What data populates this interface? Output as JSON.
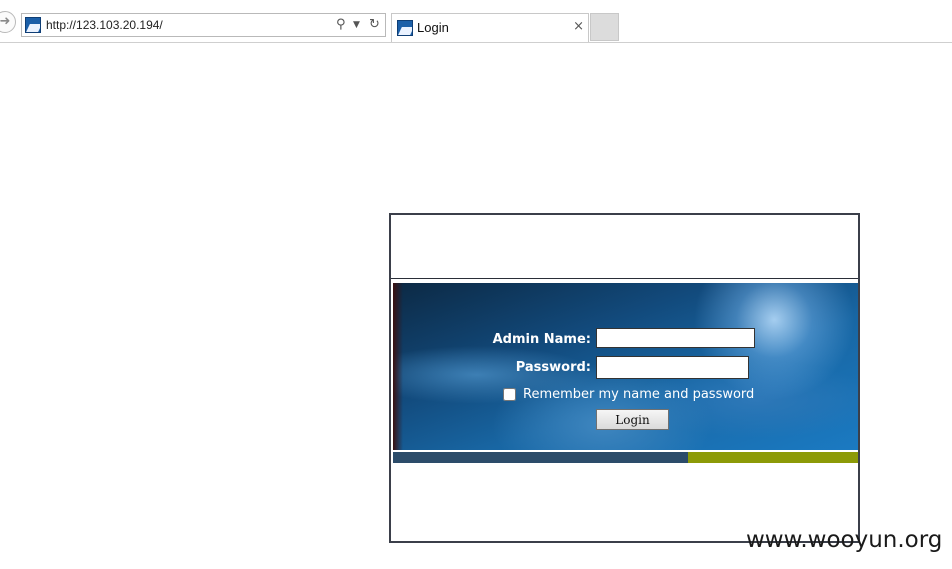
{
  "browser": {
    "url": "http://123.103.20.194/",
    "tab_title": "Login",
    "tab_close": "×",
    "icons": {
      "back": "back-arrow-icon",
      "search": "search-icon",
      "dropdown": "dropdown-arrow-icon",
      "refresh": "refresh-icon",
      "favicon": "site-favicon"
    }
  },
  "login": {
    "admin_name_label": "Admin Name:",
    "admin_name_value": "",
    "password_label": "Password:",
    "password_value": "",
    "remember_label": "Remember my name and password",
    "remember_checked": false,
    "login_button": "Login",
    "colors": {
      "frame_border": "#3b3f4a",
      "banner_blue": "#1866a3",
      "strip_dark": "#2c4c6a",
      "strip_green": "#8c9a07"
    }
  },
  "watermark": "www.wooyun.org"
}
